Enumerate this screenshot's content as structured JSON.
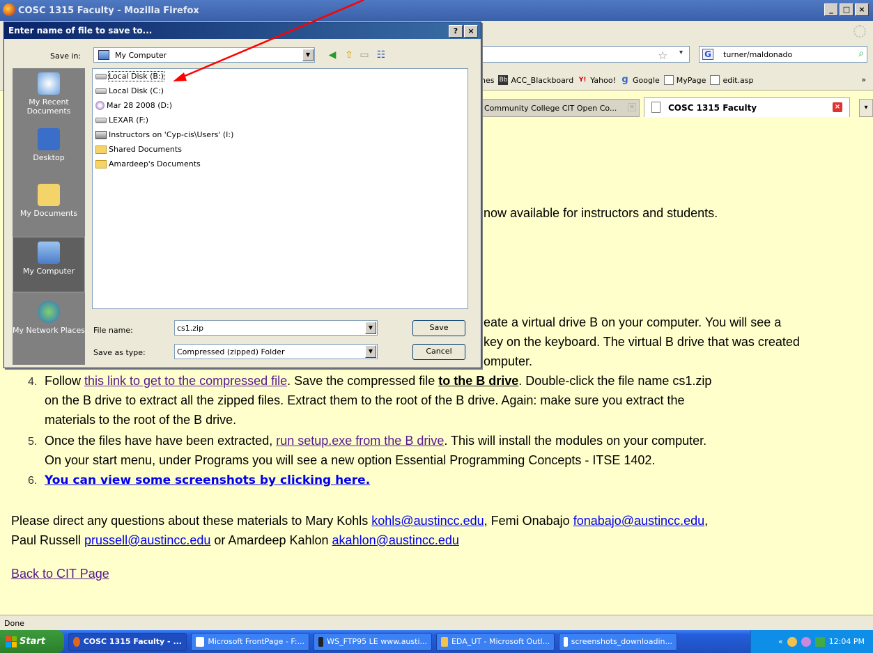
{
  "window": {
    "title": "COSC 1315 Faculty - Mozilla Firefox",
    "controls": [
      "_",
      "□",
      "×"
    ]
  },
  "browser": {
    "search_text": "turner/maldonado",
    "bookmarks_partial": "nes",
    "bookmarks": [
      "ACC_Blackboard",
      "Yahoo!",
      "Google",
      "MyPage",
      "edit.asp"
    ],
    "bookmarks_chevron": "»",
    "tab1_label": "Community College CIT Open Co...",
    "tab2_label": "COSC 1315 Faculty",
    "status": "Done"
  },
  "dialog": {
    "title": "Enter name of file to save to...",
    "title_buttons": [
      "?",
      "×"
    ],
    "save_in_label": "Save in:",
    "save_in_value": "My Computer",
    "places": [
      "My Recent Documents",
      "Desktop",
      "My Documents",
      "My Computer",
      "My Network Places"
    ],
    "files": [
      {
        "name": "Local Disk (B:)",
        "kind": "disk"
      },
      {
        "name": "Local Disk (C:)",
        "kind": "disk"
      },
      {
        "name": "Mar 28 2008 (D:)",
        "kind": "cd"
      },
      {
        "name": "LEXAR (F:)",
        "kind": "disk"
      },
      {
        "name": "Instructors on 'Cyp-cis\\Users' (I:)",
        "kind": "net"
      },
      {
        "name": "Shared Documents",
        "kind": "folder"
      },
      {
        "name": "Amardeep's Documents",
        "kind": "folder"
      }
    ],
    "file_name_label": "File name:",
    "file_name_value": "cs1.zip",
    "save_as_label": "Save as type:",
    "save_as_value": "Compressed (zipped) Folder",
    "save_button": "Save",
    "cancel_button": "Cancel"
  },
  "page": {
    "line_available": "now available for instructors and students.",
    "line_eate": "eate a virtual drive B on your computer.  You will see a",
    "line_key": "key on the keyboard.  The virtual B drive that was created",
    "line_omputer": "omputer.",
    "item4_num": "4.",
    "item4_a": "Follow ",
    "item4_link": "this link to get to the compressed file",
    "item4_b": ". Save the compressed file ",
    "item4_bold": "to the B drive",
    "item4_c": ". Double-click the file name cs1.zip",
    "item4_line2": "on the B drive to extract all the zipped files. Extract them to the root of the B drive. Again: make sure you extract the",
    "item4_line3": "materials to the root of the B drive.",
    "item5_num": "5.",
    "item5_a": "Once the files have have been extracted, ",
    "item5_link": "run setup.exe from the B drive",
    "item5_b": ". This will install the modules on your computer.",
    "item5_line2": "On your start menu, under Programs you will see a new option Essential Programming Concepts - ITSE 1402.",
    "item6_num": "6.",
    "item6_link": "You can view some screenshots by clicking here.",
    "contact_a": "Please direct any questions about these materials to Mary Kohls ",
    "contact_email1": "kohls@austincc.edu",
    "contact_b": ", Femi Onabajo ",
    "contact_email2": "fonabajo@austincc.edu",
    "contact_c": ",",
    "contact2_a": "Paul Russell ",
    "contact_email3": "prussell@austincc.edu",
    "contact2_b": " or Amardeep Kahlon ",
    "contact_email4": "akahlon@austincc.edu",
    "back_link": "Back to CIT Page"
  },
  "taskbar": {
    "start": "Start",
    "tasks": [
      "COSC 1315 Faculty - ...",
      "Microsoft FrontPage - F:...",
      "WS_FTP95 LE www.austi...",
      "EDA_UT - Microsoft Outl...",
      "screenshots_downloadin..."
    ],
    "tray_collapse": "«",
    "clock": "12:04 PM"
  },
  "colors": {
    "page_bg": "#ffffcc",
    "annotation_arrow": "#ff0000",
    "visited_link": "#551a8b",
    "link": "#0000ee"
  }
}
